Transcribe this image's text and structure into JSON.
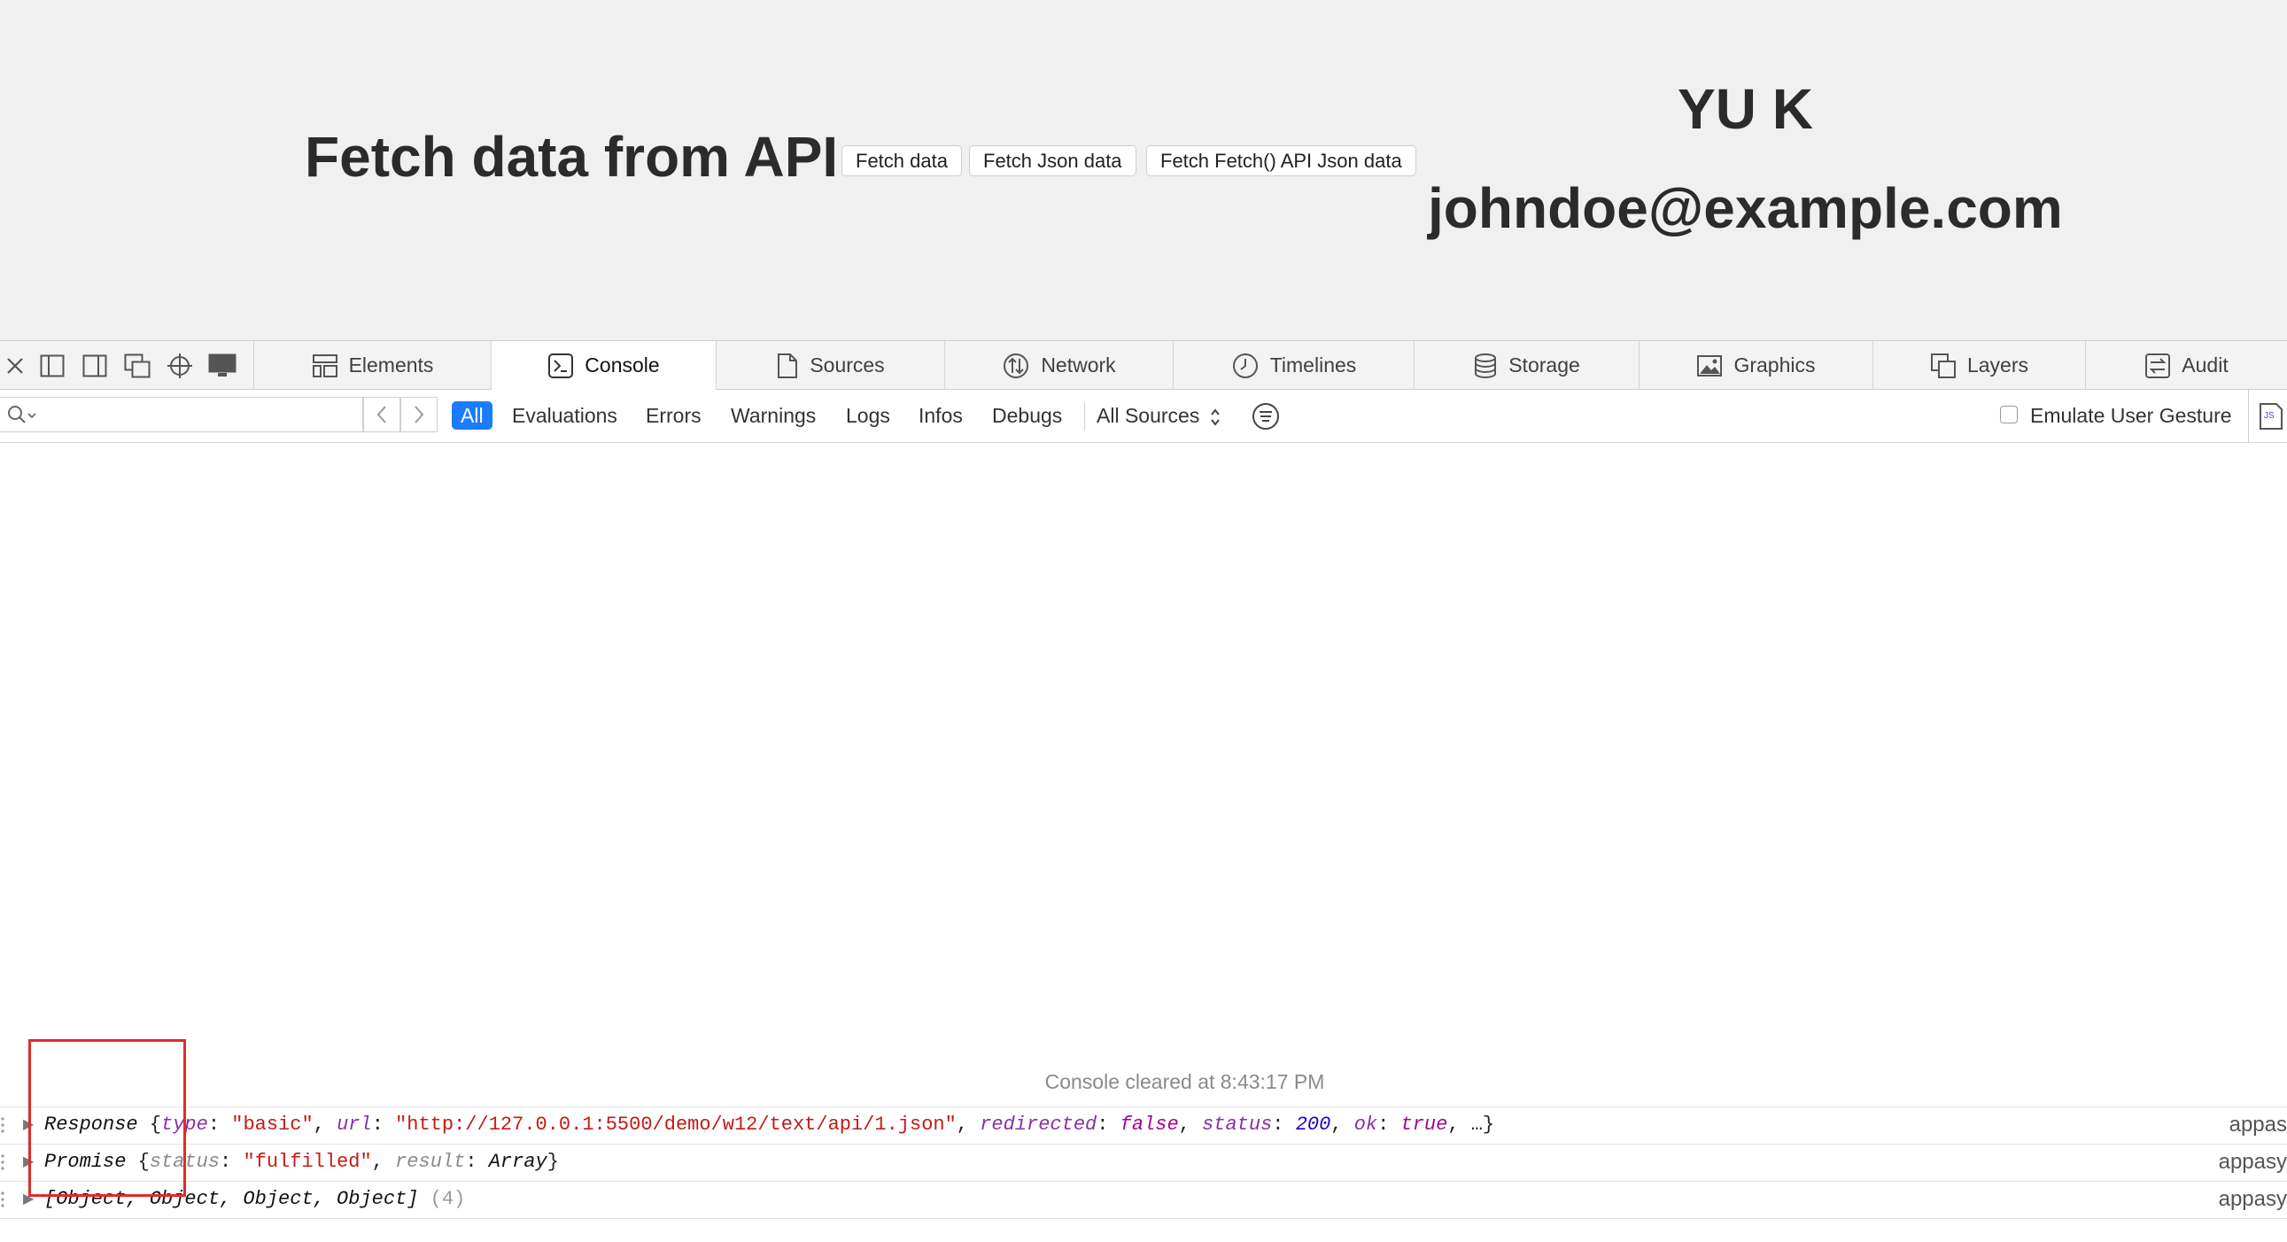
{
  "page": {
    "title": "Fetch data from API",
    "buttons": [
      "Fetch data",
      "Fetch Json data",
      "Fetch Fetch() API Json data"
    ],
    "user_name": "YU K",
    "user_email": "johndoe@example.com"
  },
  "devtools": {
    "tabs": [
      {
        "label": "Elements",
        "icon": "elements-icon"
      },
      {
        "label": "Console",
        "icon": "console-icon",
        "active": true
      },
      {
        "label": "Sources",
        "icon": "sources-icon"
      },
      {
        "label": "Network",
        "icon": "network-icon"
      },
      {
        "label": "Timelines",
        "icon": "timelines-icon"
      },
      {
        "label": "Storage",
        "icon": "storage-icon"
      },
      {
        "label": "Graphics",
        "icon": "graphics-icon"
      },
      {
        "label": "Layers",
        "icon": "layers-icon"
      },
      {
        "label": "Audit",
        "icon": "audit-icon"
      }
    ],
    "filter": {
      "search_placeholder": "",
      "levels": [
        "All",
        "Evaluations",
        "Errors",
        "Warnings",
        "Logs",
        "Infos",
        "Debugs"
      ],
      "active_level": "All",
      "sources_select": "All Sources",
      "emulate_label": "Emulate User Gesture",
      "emulate_checked": false
    },
    "console": {
      "cleared_text": "Console cleared at 8:43:17 PM",
      "messages": [
        {
          "summary": "Response {type: \"basic\", url: \"http://127.0.0.1:5500/demo/w12/text/api/1.json\", redirected: false, status: 200, ok: true, …}",
          "source": "appas"
        },
        {
          "summary": "Promise {status: \"fulfilled\", result: Array}",
          "source": "appasy"
        },
        {
          "summary": "[Object, Object, Object, Object] (4)",
          "source": "appasy"
        }
      ]
    }
  },
  "colors": {
    "accent": "#1a7cff",
    "highlight": "#e22a2a",
    "string": "#c41a16",
    "keyword": "#8a2fa8",
    "number": "#1c00cf"
  }
}
